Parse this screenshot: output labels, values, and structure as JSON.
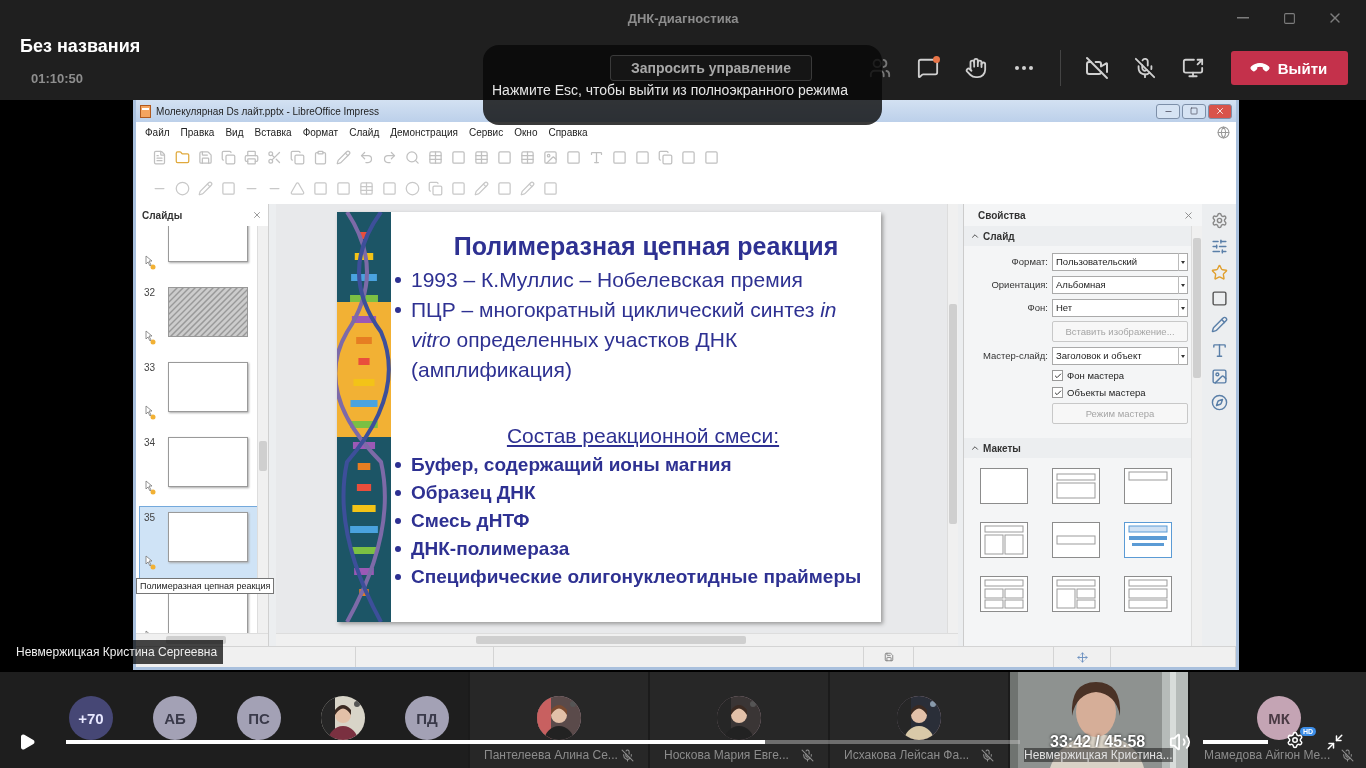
{
  "window": {
    "title": "ДНК-диагностика"
  },
  "meeting": {
    "title": "Без названия",
    "duration": "01:10:50",
    "request_control": "Запросить управление",
    "chat_unread": true,
    "camera_on": false,
    "mic_on": false,
    "leave": "Выйти"
  },
  "toast": "Нажмите Esc, чтобы выйти из полноэкранного режима",
  "presenter_label": "Невмержицкая Кристина Сергеевна",
  "shared_app": {
    "title": "Молекулярная Ds лайт.pptx - LibreOffice Impress",
    "menu": [
      "Файл",
      "Правка",
      "Вид",
      "Вставка",
      "Формат",
      "Слайд",
      "Демонстрация",
      "Сервис",
      "Окно",
      "Справка"
    ],
    "slides_panel": {
      "title": "Слайды",
      "tooltip": "Полимеразная цепная реакция",
      "items": [
        {
          "kind": "blank",
          "selected": false
        },
        {
          "number": "32",
          "kind": "hatched",
          "selected": false
        },
        {
          "number": "33",
          "kind": "blank",
          "selected": false
        },
        {
          "number": "34",
          "kind": "blank",
          "selected": false
        },
        {
          "number": "35",
          "kind": "blank",
          "selected": true
        },
        {
          "kind": "blank",
          "selected": false
        }
      ]
    },
    "slide": {
      "title": "Полимеразная цепная реакция",
      "lines": [
        {
          "kind": "bullet",
          "text": "1993 – К.Муллис – Нобелевская премия"
        },
        {
          "kind": "bullet",
          "text": "ПЦР – многократный циклический синтез *in vitro* определенных участков ДНК (амплификация)"
        },
        {
          "kind": "heading",
          "text": "Состав реакционной смеси:"
        },
        {
          "kind": "bold-bullet",
          "text": "Буфер, содержащий ионы магния"
        },
        {
          "kind": "bold-bullet",
          "text": "Образец ДНК"
        },
        {
          "kind": "bold-bullet",
          "text": "Смесь дНТФ"
        },
        {
          "kind": "bold-bullet",
          "text": "ДНК-полимераза"
        },
        {
          "kind": "bold-bullet",
          "text": "Специфические  олигонуклеотидные праймеры"
        }
      ]
    },
    "sidebar": {
      "title": "Свойства",
      "section": "Слайд",
      "rows": [
        {
          "kind": "field",
          "label": "Формат:",
          "value": "Пользовательский"
        },
        {
          "kind": "field",
          "label": "Ориентация:",
          "value": "Альбомная"
        },
        {
          "kind": "field",
          "label": "Фон:",
          "value": "Нет"
        },
        {
          "kind": "button",
          "label": "Вставить изображение...",
          "disabled": true
        },
        {
          "kind": "field",
          "label": "Мастер-слайд:",
          "value": "Заголовок и объект"
        },
        {
          "kind": "checkbox",
          "label": "Фон мастера",
          "checked": true
        },
        {
          "kind": "checkbox",
          "label": "Объекты мастера",
          "checked": true
        },
        {
          "kind": "button",
          "label": "Режим мастера",
          "disabled": true
        }
      ],
      "layouts_title": "Макеты",
      "layouts": [
        {
          "kind": "blank",
          "selected": false
        },
        {
          "kind": "title-subtitle",
          "selected": false
        },
        {
          "kind": "title-only",
          "selected": false
        },
        {
          "kind": "title-two-columns",
          "selected": false
        },
        {
          "kind": "centered-text",
          "selected": false
        },
        {
          "kind": "title-content",
          "selected": true
        },
        {
          "kind": "title-four",
          "selected": false
        },
        {
          "kind": "title-left-two",
          "selected": false
        },
        {
          "kind": "title-two-rows",
          "selected": false
        }
      ]
    }
  },
  "participants": {
    "avatars": [
      {
        "kind": "count",
        "text": "+70"
      },
      {
        "kind": "initials",
        "text": "АБ"
      },
      {
        "kind": "initials",
        "text": "ПС"
      },
      {
        "kind": "picture"
      },
      {
        "kind": "initials",
        "text": "ПД"
      }
    ],
    "tiles": [
      {
        "kind": "picture",
        "name": "Пантелеева Алина Се...",
        "muted": true
      },
      {
        "kind": "picture",
        "name": "Носкова Мария Евге...",
        "muted": true
      },
      {
        "kind": "picture",
        "name": "Исхакова Лейсан Фа...",
        "muted": true
      },
      {
        "kind": "video",
        "name": "Невмержицкая Кристина...",
        "muted": false
      },
      {
        "kind": "initials",
        "initials": "МК",
        "name": "Мамедова Айгюн Ме...",
        "muted": true
      }
    ]
  },
  "player": {
    "level": 0.733,
    "time": "33:42 / 45:58",
    "volume": {
      "level": 1
    },
    "quality": "HD"
  }
}
